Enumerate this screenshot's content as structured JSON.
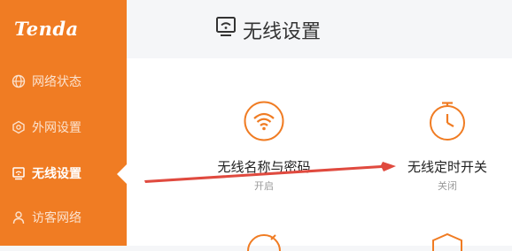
{
  "brand": {
    "logo_text": "Tenda"
  },
  "sidebar": {
    "items": [
      {
        "label": "网络状态",
        "icon": "globe-icon"
      },
      {
        "label": "外网设置",
        "icon": "network-icon"
      },
      {
        "label": "无线设置",
        "icon": "wifi-settings-icon",
        "active": true
      },
      {
        "label": "访客网络",
        "icon": "user-icon"
      }
    ]
  },
  "header": {
    "title": "无线设置",
    "icon": "wifi-settings-icon"
  },
  "cards": [
    {
      "title": "无线名称与密码",
      "status": "开启",
      "icon": "wifi-icon"
    },
    {
      "title": "无线定时开关",
      "status": "关闭",
      "icon": "timer-icon"
    }
  ],
  "colors": {
    "brand": "#f07c23",
    "annotation_arrow": "#e04a3f",
    "status_text": "#999999"
  }
}
